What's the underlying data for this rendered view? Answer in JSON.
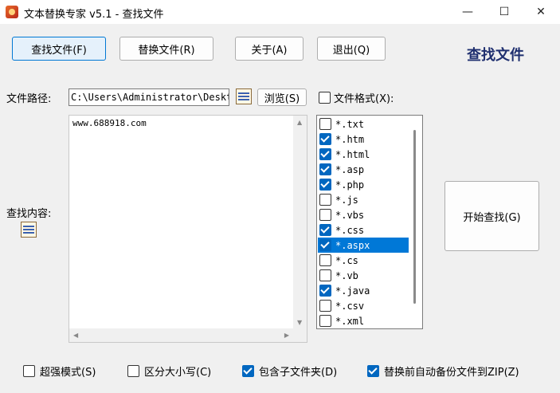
{
  "window": {
    "title": "文本替换专家 v5.1 - 查找文件",
    "minimize_glyph": "—",
    "maximize_glyph": "☐",
    "close_glyph": "✕"
  },
  "toolbar": {
    "find_files": "查找文件(F)",
    "replace_files": "替换文件(R)",
    "about": "关于(A)",
    "exit": "退出(Q)"
  },
  "page_heading": "查找文件",
  "path": {
    "label": "文件路径:",
    "value": "C:\\Users\\Administrator\\Desktop",
    "browse": "浏览(S)"
  },
  "file_format": {
    "label": "文件格式(X):",
    "checked": false
  },
  "content": {
    "label": "查找内容:",
    "text": "www.688918.com"
  },
  "extensions": [
    {
      "name": "*.txt",
      "checked": false
    },
    {
      "name": "*.htm",
      "checked": true
    },
    {
      "name": "*.html",
      "checked": true
    },
    {
      "name": "*.asp",
      "checked": true
    },
    {
      "name": "*.php",
      "checked": true
    },
    {
      "name": "*.js",
      "checked": false
    },
    {
      "name": "*.vbs",
      "checked": false
    },
    {
      "name": "*.css",
      "checked": true
    },
    {
      "name": "*.aspx",
      "checked": true,
      "selected": true
    },
    {
      "name": "*.cs",
      "checked": false
    },
    {
      "name": "*.vb",
      "checked": false
    },
    {
      "name": "*.java",
      "checked": true
    },
    {
      "name": "*.csv",
      "checked": false
    },
    {
      "name": "*.xml",
      "checked": false
    }
  ],
  "start_search": "开始查找(G)",
  "options": {
    "super_mode": {
      "label": "超强模式(S)",
      "checked": false
    },
    "case_sensitive": {
      "label": "区分大小写(C)",
      "checked": false
    },
    "include_subfolders": {
      "label": "包含子文件夹(D)",
      "checked": true
    },
    "backup_zip": {
      "label": "替换前自动备份文件到ZIP(Z)",
      "checked": true
    }
  },
  "colors": {
    "accent": "#0078d4",
    "heading": "#1f2f6f",
    "selection": "#0078d7"
  }
}
